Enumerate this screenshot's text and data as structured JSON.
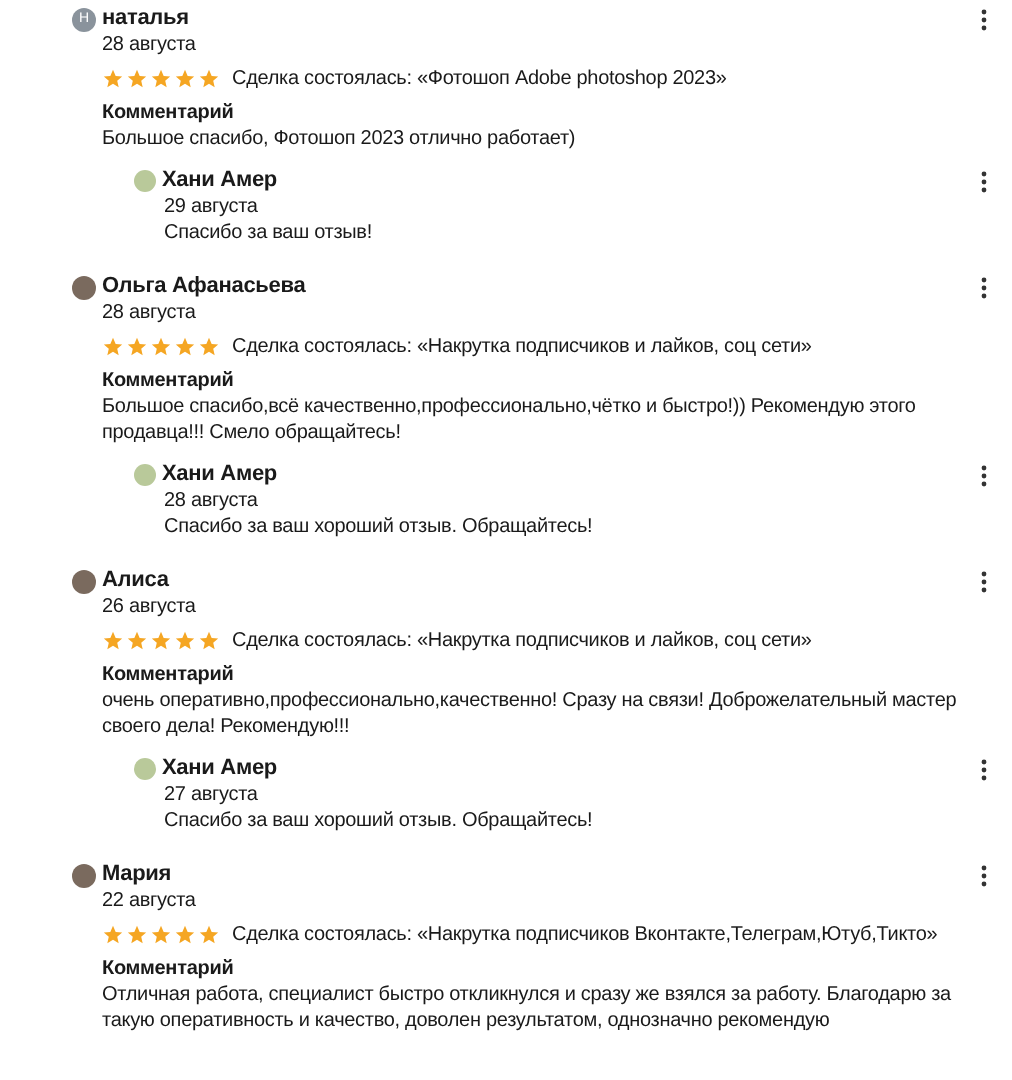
{
  "reviews": [
    {
      "author": "наталья",
      "avatar_letter": "Н",
      "date": "28 августа",
      "stars": 5,
      "deal": "Сделка состоялась: «Фотошоп Adobe photoshop 2023»",
      "comment_label": "Комментарий",
      "comment": "Большое спасибо, Фотошоп 2023 отлично работает)",
      "reply": {
        "author": "Хани Амер",
        "date": "29 августа",
        "text": "Спасибо за ваш отзыв!"
      }
    },
    {
      "author": "Ольга Афанасьева",
      "date": "28 августа",
      "stars": 5,
      "deal": "Сделка состоялась: «Накрутка подписчиков и лайков, соц сети»",
      "comment_label": "Комментарий",
      "comment": "Большое спасибо,всё качественно,профессионально,чётко и быстро!)) Рекомендую этого продавца!!! Смело обращайтесь!",
      "reply": {
        "author": "Хани Амер",
        "date": "28 августа",
        "text": "Спасибо за ваш хороший отзыв. Обращайтесь!"
      }
    },
    {
      "author": "Алиса",
      "date": "26 августа",
      "stars": 5,
      "deal": "Сделка состоялась: «Накрутка подписчиков и лайков, соц сети»",
      "comment_label": "Комментарий",
      "comment": "очень оперативно,профессионально,качественно! Сразу на связи! Доброжелательный мастер своего дела! Рекомендую!!!",
      "reply": {
        "author": "Хани Амер",
        "date": "27 августа",
        "text": "Спасибо за ваш хороший отзыв. Обращайтесь!"
      }
    },
    {
      "author": "Мария",
      "date": "22 августа",
      "stars": 5,
      "deal": "Сделка состоялась: «Накрутка подписчиков Вконтакте,Телеграм,Ютуб,Тикто»",
      "comment_label": "Комментарий",
      "comment": "Отличная работа, специалист быстро откликнулся и сразу же взялся за работу. Благодарю за такую оперативность и качество, доволен результатом, однозначно рекомендую"
    }
  ]
}
